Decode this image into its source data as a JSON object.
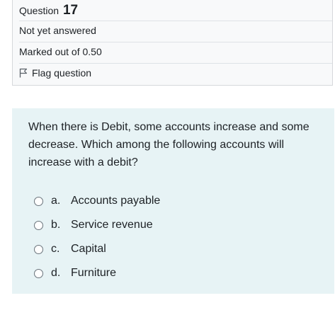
{
  "info": {
    "question_label": "Question",
    "question_number": "17",
    "status": "Not yet answered",
    "marks": "Marked out of 0.50",
    "flag_label": "Flag question"
  },
  "question": {
    "text": "When there is Debit, some accounts increase and some decrease. Which among the following accounts will increase with a debit?",
    "options": [
      {
        "letter": "a.",
        "text": "Accounts payable"
      },
      {
        "letter": "b.",
        "text": "Service revenue"
      },
      {
        "letter": "c.",
        "text": "Capital"
      },
      {
        "letter": "d.",
        "text": "Furniture"
      }
    ]
  },
  "icons": {
    "flag": "flag-icon",
    "radio": "radio-unchecked-icon"
  }
}
